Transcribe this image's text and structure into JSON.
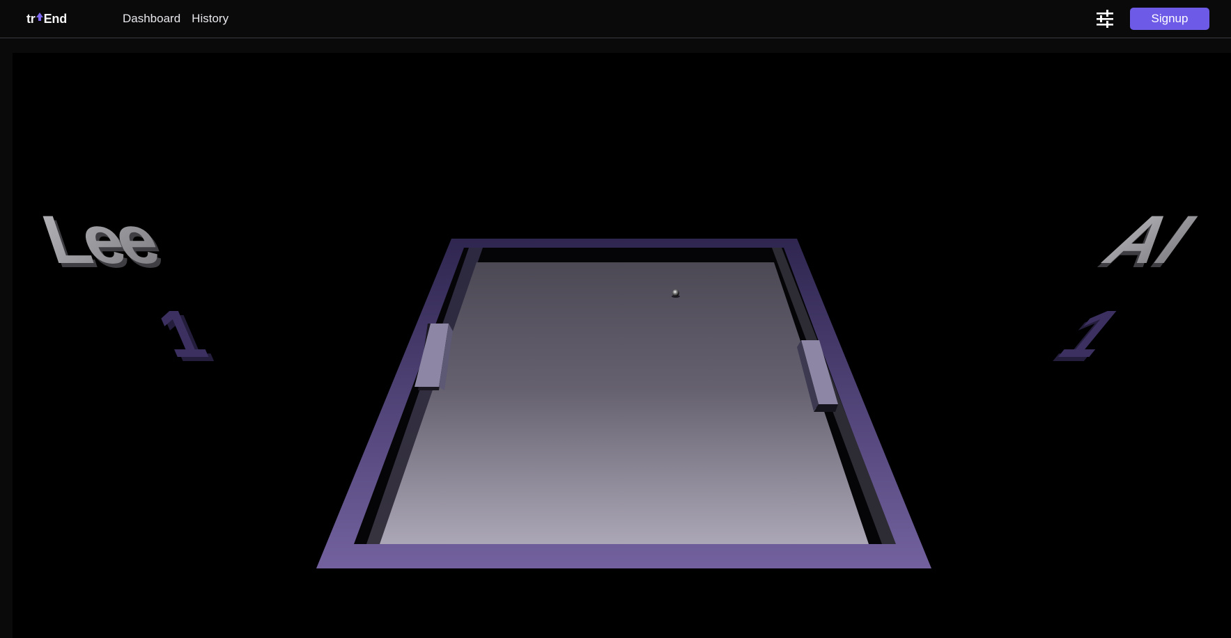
{
  "nav": {
    "logo_prefix": "tr",
    "logo_suffix": "End",
    "links": [
      {
        "label": "Dashboard"
      },
      {
        "label": "History"
      }
    ],
    "settings_icon": "sliders-icon",
    "signup_label": "Signup"
  },
  "game": {
    "player_left": {
      "name": "Lee",
      "score": "1"
    },
    "player_right": {
      "name": "AI",
      "score": "1"
    }
  },
  "colors": {
    "accent": "#6d5ae6",
    "frame_purple": "#5c4b91",
    "table_top": "#4d4a56",
    "table_bottom": "#aaa5b4",
    "paddle": "#8e87a6",
    "name_text": "#8a8a8e",
    "score_text": "#3a2f5c"
  }
}
